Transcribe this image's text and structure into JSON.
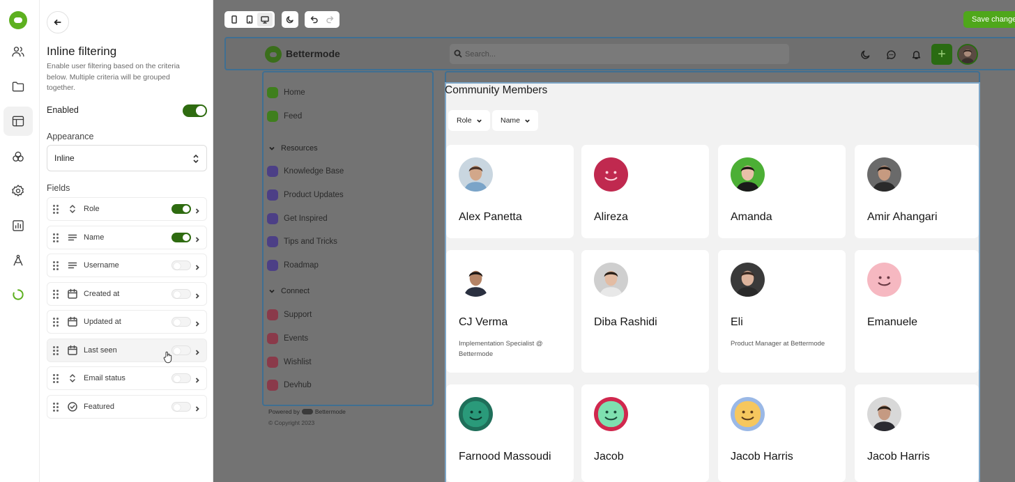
{
  "panel": {
    "title": "Inline filtering",
    "description": "Enable user filtering based on the criteria below. Multiple criteria will be grouped together.",
    "enabled_label": "Enabled",
    "enabled": true,
    "appearance_label": "Appearance",
    "appearance_value": "Inline",
    "fields_label": "Fields",
    "fields": [
      {
        "label": "Role",
        "icon": "selector-icon",
        "enabled": true
      },
      {
        "label": "Name",
        "icon": "text-lines-icon",
        "enabled": true
      },
      {
        "label": "Username",
        "icon": "text-lines-icon",
        "enabled": false
      },
      {
        "label": "Created at",
        "icon": "calendar-icon",
        "enabled": false
      },
      {
        "label": "Updated at",
        "icon": "calendar-icon",
        "enabled": false
      },
      {
        "label": "Last seen",
        "icon": "calendar-icon",
        "enabled": false
      },
      {
        "label": "Email status",
        "icon": "selector-icon",
        "enabled": false
      },
      {
        "label": "Featured",
        "icon": "check-circle-icon",
        "enabled": false
      }
    ]
  },
  "toolbar": {
    "save_label": "Save changes"
  },
  "site": {
    "brand": "Bettermode",
    "search_placeholder": "Search...",
    "nav": [
      {
        "label": "Home",
        "color": "#3f7f1d"
      },
      {
        "label": "Feed",
        "color": "#3f7f1d"
      }
    ],
    "sections": [
      {
        "title": "Resources",
        "items": [
          {
            "label": "Knowledge Base",
            "color": "#4c3f86"
          },
          {
            "label": "Product Updates",
            "color": "#4c3f86"
          },
          {
            "label": "Get Inspired",
            "color": "#4c3f86"
          },
          {
            "label": "Tips and Tricks",
            "color": "#4c3f86"
          },
          {
            "label": "Roadmap",
            "color": "#4c3f86"
          }
        ]
      },
      {
        "title": "Connect",
        "items": [
          {
            "label": "Support",
            "color": "#8a3a4a"
          },
          {
            "label": "Events",
            "color": "#8a3a4a"
          },
          {
            "label": "Wishlist",
            "color": "#8a3a4a"
          },
          {
            "label": "Devhub",
            "color": "#8a3a4a"
          }
        ]
      }
    ],
    "powered_by": "Powered by",
    "powered_brand": "Bettermode",
    "copyright": "© Copyright 2023"
  },
  "members": {
    "title": "Community Members",
    "filters": [
      "Role",
      "Name"
    ],
    "cards": [
      {
        "name": "Alex Panetta",
        "title": "",
        "avatar": "photo"
      },
      {
        "name": "Alireza",
        "title": "",
        "avatar": "smiley-crimson"
      },
      {
        "name": "Amanda",
        "title": "",
        "avatar": "photo"
      },
      {
        "name": "Amir Ahangari",
        "title": "",
        "avatar": "photo"
      },
      {
        "name": "CJ Verma",
        "title": "Implementation Specialist @ Bettermode",
        "avatar": "photo"
      },
      {
        "name": "Diba Rashidi",
        "title": "",
        "avatar": "photo"
      },
      {
        "name": "Eli",
        "title": "Product Manager at Bettermode",
        "avatar": "photo"
      },
      {
        "name": "Emanuele",
        "title": "",
        "avatar": "smiley-pink"
      },
      {
        "name": "Farnood Massoudi",
        "title": "",
        "avatar": "smiley-teal"
      },
      {
        "name": "Jacob",
        "title": "",
        "avatar": "smiley-mint"
      },
      {
        "name": "Jacob Harris",
        "title": "",
        "avatar": "smiley-yellow"
      },
      {
        "name": "Jacob Harris",
        "title": "",
        "avatar": "photo"
      }
    ]
  },
  "colors": {
    "accent": "#2e6b10",
    "brand_green": "#5db01f",
    "selection_outline": "#3f6f92"
  }
}
